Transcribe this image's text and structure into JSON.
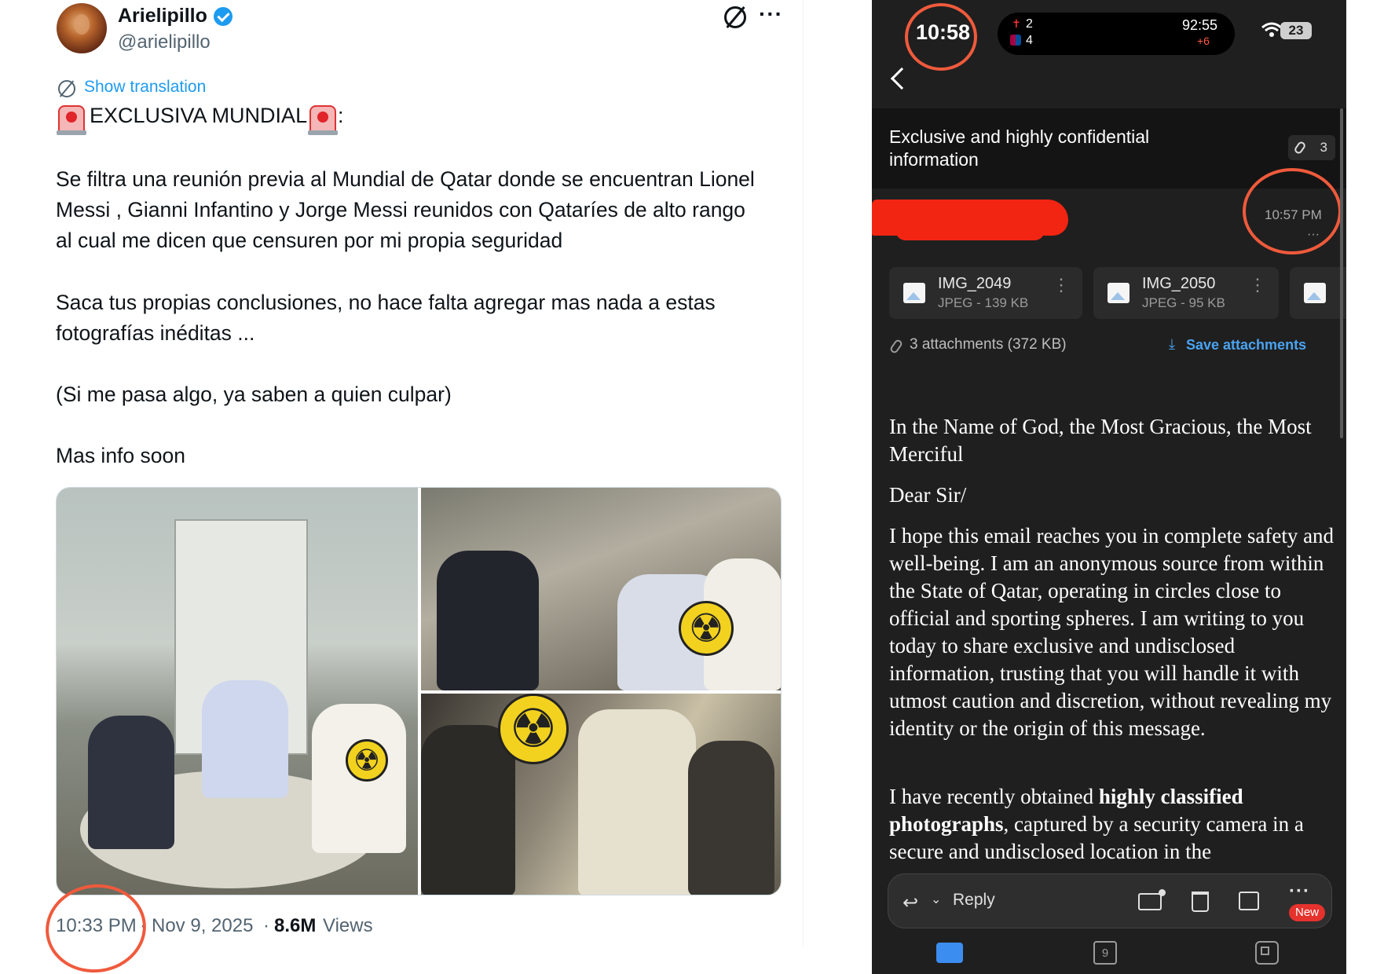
{
  "tweet": {
    "author_name": "Arielipillo",
    "handle": "@arielipillo",
    "show_translation": "Show translation",
    "heading": "EXCLUSIVA MUNDIAL",
    "heading_colon": ":",
    "paragraphs": [
      "Se filtra una reunión previa al Mundial de Qatar donde se encuentran Lionel Messi , Gianni Infantino y Jorge Messi reunidos con Qataríes de alto rango al cual me dicen que censuren por mi propia seguridad",
      "Saca tus propias conclusiones, no hace falta agregar mas nada a estas fotografías inéditas ...",
      "(Si me pasa algo, ya saben a quien culpar)",
      "Mas info soon"
    ],
    "time": "10:33 PM",
    "separator": "·",
    "date": "Nov 9, 2025",
    "views_count": "8.6M",
    "views_label": "Views",
    "annotation_color": "#ef5a3c"
  },
  "phone": {
    "status_time": "10:58",
    "live_activity": {
      "team1_score": "2",
      "team2_score": "4",
      "clock": "92:55",
      "added_time": "+6"
    },
    "battery": "23",
    "email": {
      "subject": "Exclusive and highly confidential information",
      "attachment_count": "3",
      "time": "10:57 PM",
      "more": "···",
      "attachments": [
        {
          "name": "IMG_2049",
          "meta": "JPEG - 139 KB"
        },
        {
          "name": "IMG_2050",
          "meta": "JPEG - 95 KB"
        }
      ],
      "summary": "3 attachments (372 KB)",
      "save_label": "Save attachments",
      "body": {
        "p1": "In the Name of God, the Most Gracious, the Most Merciful",
        "p2": "Dear Sir/",
        "p3": "I hope this email reaches you in complete safety and well-being. I am an anonymous source from within the State of Qatar, operating in circles close to official and sporting spheres. I am writing to you today to share exclusive and undisclosed information, trusting that you will handle it with utmost caution and discretion, without revealing my identity or the origin of this message.",
        "p4_a": "I have recently obtained ",
        "p4_bold": "highly classified photographs",
        "p4_b": ", captured by a security camera in a secure and undisclosed location in the"
      }
    },
    "toolbar": {
      "reply_label": "Reply",
      "new_badge": "New"
    },
    "tabbar": {
      "calendar_day": "9"
    },
    "accent": "#4aa3f0",
    "redaction_color": "#f22513"
  }
}
